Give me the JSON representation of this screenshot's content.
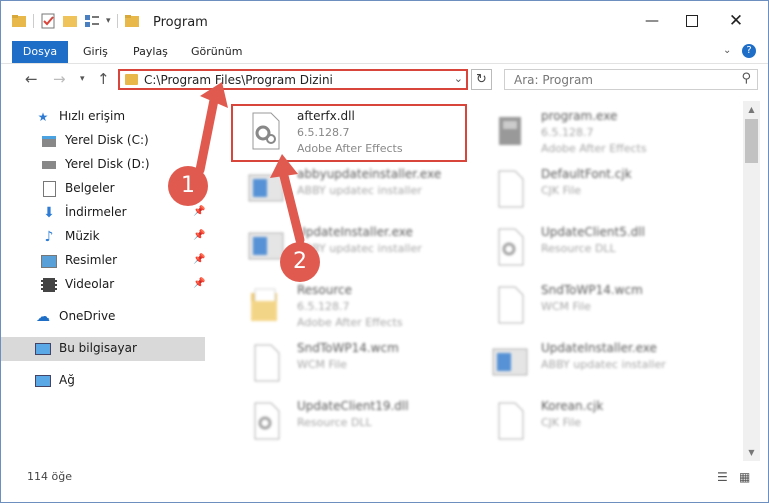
{
  "window": {
    "title": "Program"
  },
  "ribbon": {
    "tabs": [
      "Dosya",
      "Giriş",
      "Paylaş",
      "Görünüm"
    ]
  },
  "address": {
    "path": "C:\\Program Files\\Program Dizini",
    "search_placeholder": "Ara: Program"
  },
  "sidebar": {
    "items": [
      {
        "label": "Hızlı erişim",
        "icon": "star-icon",
        "pinned": false
      },
      {
        "label": "Yerel Disk (C:)",
        "icon": "drive-icon",
        "pinned": false
      },
      {
        "label": "Yerel Disk (D:)",
        "icon": "drive-icon",
        "pinned": false
      },
      {
        "label": "Belgeler",
        "icon": "document-icon",
        "pinned": false
      },
      {
        "label": "İndirmeler",
        "icon": "download-icon",
        "pinned": true
      },
      {
        "label": "Müzik",
        "icon": "music-icon",
        "pinned": true
      },
      {
        "label": "Resimler",
        "icon": "pictures-icon",
        "pinned": true
      },
      {
        "label": "Videolar",
        "icon": "video-icon",
        "pinned": true
      },
      {
        "label": "OneDrive",
        "icon": "cloud-icon",
        "pinned": false
      },
      {
        "label": "Bu bilgisayar",
        "icon": "computer-icon",
        "pinned": false
      },
      {
        "label": "Ağ",
        "icon": "network-icon",
        "pinned": false
      }
    ]
  },
  "files": [
    {
      "name": "afterfx.dll",
      "line1": "6.5.128.7",
      "line2": "Adobe After Effects",
      "icon": "dll-icon"
    },
    {
      "name": "program.exe",
      "line1": "6.5.128.7",
      "line2": "Adobe After Effects",
      "icon": "exe-icon"
    },
    {
      "name": "abbyupdateinstaller.exe",
      "line1": "ABBY updatec installer",
      "line2": "",
      "icon": "installer-icon"
    },
    {
      "name": "DefaultFont.cjk",
      "line1": "CJK File",
      "line2": "",
      "icon": "file-icon"
    },
    {
      "name": "UpdateInstaller.exe",
      "line1": "ABBY updatec installer",
      "line2": "",
      "icon": "installer-icon"
    },
    {
      "name": "UpdateClient5.dll",
      "line1": "Resource DLL",
      "line2": "",
      "icon": "dll-icon"
    },
    {
      "name": "Resource",
      "line1": "6.5.128.7",
      "line2": "Adobe After Effects",
      "icon": "folder-icon"
    },
    {
      "name": "SndToWP14.wcm",
      "line1": "WCM File",
      "line2": "",
      "icon": "file-icon"
    },
    {
      "name": "SndToWP14.wcm",
      "line1": "WCM File",
      "line2": "",
      "icon": "file-icon"
    },
    {
      "name": "UpdateInstaller.exe",
      "line1": "ABBY updatec installer",
      "line2": "",
      "icon": "installer-icon"
    },
    {
      "name": "UpdateClient19.dll",
      "line1": "Resource DLL",
      "line2": "",
      "icon": "dll-icon"
    },
    {
      "name": "Korean.cjk",
      "line1": "CJK File",
      "line2": "",
      "icon": "file-icon"
    }
  ],
  "status": {
    "count": "114 öğe"
  },
  "annotations": {
    "step1": "1",
    "step2": "2",
    "color": "#e05a4f"
  }
}
